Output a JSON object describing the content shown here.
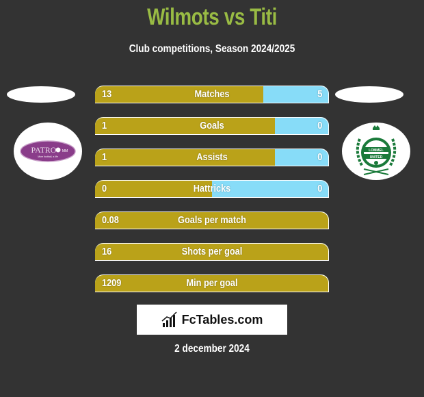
{
  "header": {
    "title": "Wilmots vs Titi",
    "subtitle": "Club competitions, Season 2024/2025"
  },
  "teams": {
    "left": {
      "name": "Patro Maasmechelen",
      "logo_text": "PATRO",
      "logo_suffix": "MM",
      "logo_tagline": "More football, a life"
    },
    "right": {
      "name": "Lommel United",
      "logo_text_1": "LOMMEL",
      "logo_text_2": "UNITED"
    }
  },
  "colors": {
    "left_bar": "#baa219",
    "right_bar": "#87dcf8",
    "title": "#99bb44",
    "background": "#333333"
  },
  "stats": [
    {
      "label": "Matches",
      "left": "13",
      "right": "5",
      "left_share": 0.72
    },
    {
      "label": "Goals",
      "left": "1",
      "right": "0",
      "left_share": 0.77
    },
    {
      "label": "Assists",
      "left": "1",
      "right": "0",
      "left_share": 0.77
    },
    {
      "label": "Hattricks",
      "left": "0",
      "right": "0",
      "left_share": 0.5
    },
    {
      "label": "Goals per match",
      "left": "0.08",
      "right": "",
      "left_share": 1.0
    },
    {
      "label": "Shots per goal",
      "left": "16",
      "right": "",
      "left_share": 1.0
    },
    {
      "label": "Min per goal",
      "left": "1209",
      "right": "",
      "left_share": 1.0
    }
  ],
  "brand": {
    "name": "FcTables.com",
    "icon": "bar-chart-icon"
  },
  "footer": {
    "date": "2 december 2024"
  }
}
